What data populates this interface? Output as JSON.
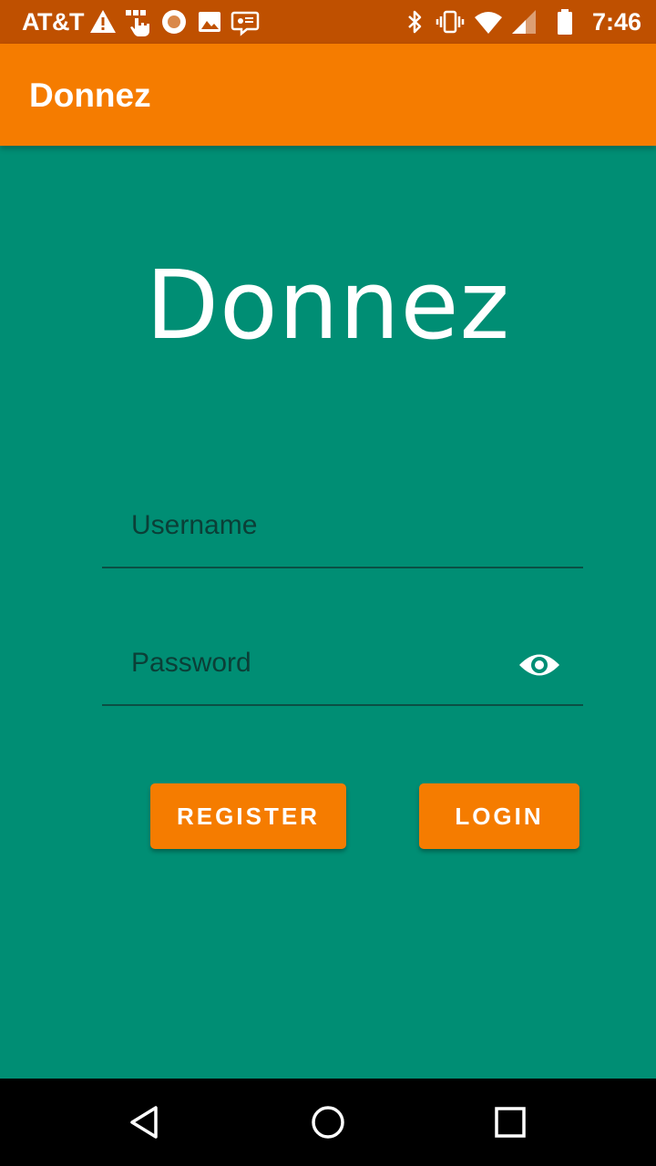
{
  "status_bar": {
    "carrier": "AT&T",
    "time": "7:46",
    "left_icons": [
      "warning-icon",
      "touch-icon",
      "record-icon",
      "image-icon",
      "message-icon"
    ],
    "right_icons": [
      "bluetooth-icon",
      "vibrate-icon",
      "wifi-icon",
      "signal-icon",
      "battery-icon"
    ]
  },
  "app_bar": {
    "title": "Donnez"
  },
  "main": {
    "headline": "Donnez",
    "username": {
      "placeholder": "Username",
      "value": ""
    },
    "password": {
      "placeholder": "Password",
      "value": "",
      "toggle_icon": "eye-icon"
    },
    "register_label": "REGISTER",
    "login_label": "LOGIN"
  },
  "nav_bar": {
    "icons": [
      "back-icon",
      "home-icon",
      "recents-icon"
    ]
  },
  "colors": {
    "status_bar": "#BF5000",
    "app_bar": "#F57C00",
    "background": "#008E74",
    "accent": "#F57C00",
    "underline": "#0B4F44"
  }
}
